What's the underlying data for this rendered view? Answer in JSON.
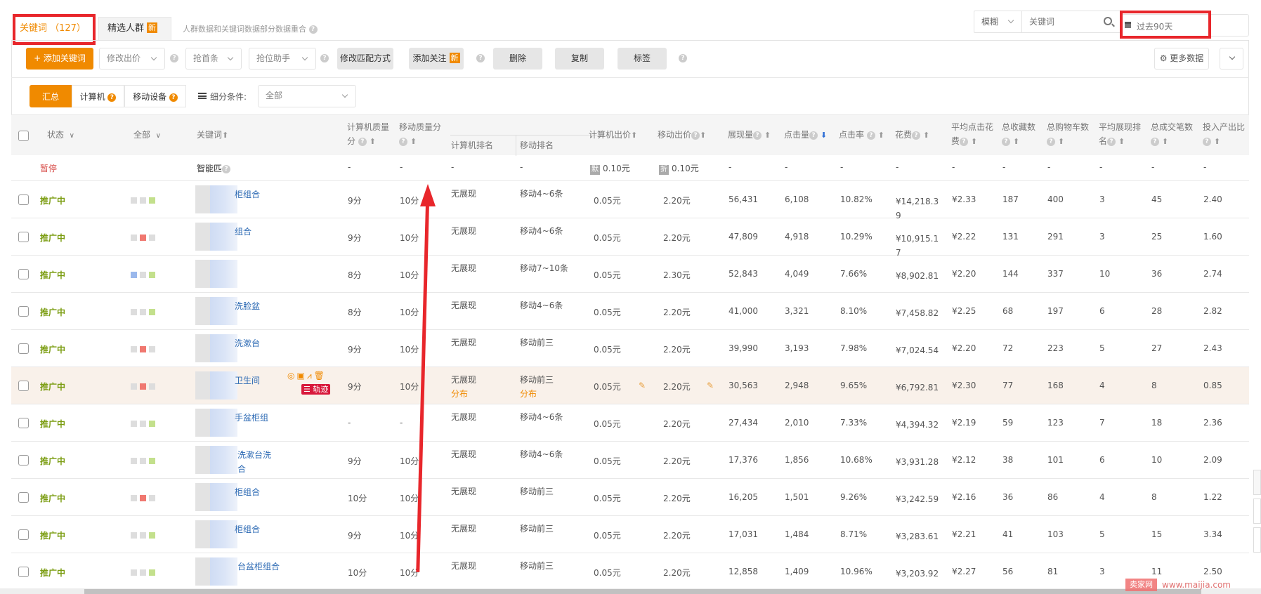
{
  "tabs": {
    "keywords": "关键词 （127）",
    "crowd": "精选人群",
    "crowd_badge": "新",
    "note": "人群数据和关键词数据部分数据重合"
  },
  "search": {
    "mode": "模糊",
    "placeholder": "关键词",
    "icon": "search-icon"
  },
  "date_range": "过去90天",
  "toolbar": {
    "add_keyword": "+ 添加关键词",
    "modify_bid": "修改出价",
    "grab_first": "抢首条",
    "rank_helper": "抢位助手",
    "modify_match": "修改匹配方式",
    "add_follow": "添加关注",
    "add_follow_badge": "新",
    "delete": "删除",
    "copy": "复制",
    "tag": "标签",
    "more_data": "更多数据"
  },
  "segments": {
    "summary": "汇总",
    "pc": "计算机",
    "mobile": "移动设备",
    "filter_label": "细分条件:",
    "filter_value": "全部"
  },
  "columns": {
    "status": "状态",
    "all": "全部",
    "keyword": "关键词",
    "pc_quality_1": "计算机质量",
    "pc_quality_2": "分",
    "mobile_quality_1": "移动质量分",
    "pc_rank": "计算机排名",
    "mobile_rank": "移动排名",
    "pc_bid": "计算机出价",
    "mobile_bid": "移动出价",
    "impressions": "展现量",
    "clicks": "点击量",
    "ctr": "点击率",
    "cost": "花费",
    "avg_cpc_1": "平均点击花",
    "avg_cpc_2": "费",
    "favorites": "总收藏数",
    "carts": "总购物车数",
    "avg_rank_1": "平均展现排",
    "avg_rank_2": "名",
    "orders": "总成交笔数",
    "roi": "投入产出比"
  },
  "smart_row": {
    "status": "暂停",
    "keyword": "智能匹",
    "pc_q": "-",
    "m_q": "-",
    "pc_rank": "-",
    "m_rank": "-",
    "pc_bid_tag": "默",
    "pc_bid": "0.10元",
    "m_bid_tag": "折",
    "m_bid": "0.10元",
    "impressions": "-",
    "clicks": "-",
    "ctr": "-",
    "cost": "-",
    "cpc": "-",
    "fav": "-",
    "cart": "-",
    "rank": "-",
    "orders": "-",
    "roi": "-"
  },
  "rows": [
    {
      "status": "推广中",
      "squares": [
        "n",
        "n",
        "g"
      ],
      "keyword": "柜组合",
      "pc_q": "9分",
      "m_q": "10分",
      "pc_rank": "无展现",
      "m_rank": "移动4~6条",
      "pc_bid": "0.05元",
      "m_bid": "2.20元",
      "impressions": "56,431",
      "clicks": "6,108",
      "ctr": "10.82%",
      "cost": "¥14,218.39",
      "cpc": "¥2.33",
      "fav": "187",
      "cart": "400",
      "rank": "3",
      "orders": "45",
      "roi": "2.40"
    },
    {
      "status": "推广中",
      "squares": [
        "n",
        "r",
        "n"
      ],
      "keyword": "组合",
      "pc_q": "9分",
      "m_q": "10分",
      "pc_rank": "无展现",
      "m_rank": "移动4~6条",
      "pc_bid": "0.05元",
      "m_bid": "2.20元",
      "impressions": "47,809",
      "clicks": "4,918",
      "ctr": "10.29%",
      "cost": "¥10,915.17",
      "cpc": "¥2.22",
      "fav": "131",
      "cart": "291",
      "rank": "3",
      "orders": "25",
      "roi": "1.60"
    },
    {
      "status": "推广中",
      "squares": [
        "b",
        "n",
        "g"
      ],
      "keyword": "",
      "pc_q": "8分",
      "m_q": "10分",
      "pc_rank": "无展现",
      "m_rank": "移动7~10条",
      "pc_bid": "0.05元",
      "m_bid": "2.30元",
      "impressions": "52,843",
      "clicks": "4,049",
      "ctr": "7.66%",
      "cost": "¥8,902.81",
      "cpc": "¥2.20",
      "fav": "144",
      "cart": "337",
      "rank": "10",
      "orders": "36",
      "roi": "2.74"
    },
    {
      "status": "推广中",
      "squares": [
        "n",
        "n",
        "g"
      ],
      "keyword": "洗脸盆",
      "pc_q": "8分",
      "m_q": "10分",
      "pc_rank": "无展现",
      "m_rank": "移动4~6条",
      "pc_bid": "0.05元",
      "m_bid": "2.20元",
      "impressions": "41,000",
      "clicks": "3,321",
      "ctr": "8.10%",
      "cost": "¥7,458.82",
      "cpc": "¥2.25",
      "fav": "68",
      "cart": "197",
      "rank": "6",
      "orders": "28",
      "roi": "2.82"
    },
    {
      "status": "推广中",
      "squares": [
        "n",
        "r",
        "n"
      ],
      "keyword": "洗漱台",
      "pc_q": "9分",
      "m_q": "10分",
      "pc_rank": "无展现",
      "m_rank": "移动前三",
      "pc_bid": "0.05元",
      "m_bid": "2.20元",
      "impressions": "39,990",
      "clicks": "3,193",
      "ctr": "7.98%",
      "cost": "¥7,024.54",
      "cpc": "¥2.20",
      "fav": "72",
      "cart": "223",
      "rank": "5",
      "orders": "27",
      "roi": "2.43"
    },
    {
      "status": "推广中",
      "squares": [
        "n",
        "r",
        "n"
      ],
      "keyword": "卫生间",
      "pc_q": "9分",
      "m_q": "10分",
      "pc_rank": "无展现",
      "m_rank": "移动前三",
      "pc_rank_sub": "分布",
      "m_rank_sub": "分布",
      "pc_bid": "0.05元",
      "m_bid": "2.20元",
      "impressions": "30,563",
      "clicks": "2,948",
      "ctr": "9.65%",
      "cost": "¥6,792.81",
      "cpc": "¥2.30",
      "fav": "77",
      "cart": "168",
      "rank": "4",
      "orders": "8",
      "roi": "0.85",
      "track": "轨迹",
      "highlight": true
    },
    {
      "status": "推广中",
      "squares": [
        "n",
        "n",
        "g"
      ],
      "keyword": "手盆柜组",
      "pc_q": "-",
      "m_q": "-",
      "pc_rank": "无展现",
      "m_rank": "移动4~6条",
      "pc_bid": "0.05元",
      "m_bid": "2.20元",
      "impressions": "27,434",
      "clicks": "2,010",
      "ctr": "7.33%",
      "cost": "¥4,394.32",
      "cpc": "¥2.19",
      "fav": "59",
      "cart": "123",
      "rank": "7",
      "orders": "18",
      "roi": "2.36"
    },
    {
      "status": "推广中",
      "squares": [
        "n",
        "n",
        "g"
      ],
      "keyword": "洗漱台洗 合",
      "pc_q": "9分",
      "m_q": "10分",
      "pc_rank": "无展现",
      "m_rank": "移动4~6条",
      "pc_bid": "0.05元",
      "m_bid": "2.20元",
      "impressions": "17,376",
      "clicks": "1,856",
      "ctr": "10.68%",
      "cost": "¥3,931.28",
      "cpc": "¥2.12",
      "fav": "38",
      "cart": "101",
      "rank": "6",
      "orders": "10",
      "roi": "2.09"
    },
    {
      "status": "推广中",
      "squares": [
        "n",
        "r",
        "n"
      ],
      "keyword": "柜组合",
      "pc_q": "10分",
      "m_q": "10分",
      "pc_rank": "无展现",
      "m_rank": "移动前三",
      "pc_bid": "0.05元",
      "m_bid": "2.20元",
      "impressions": "16,205",
      "clicks": "1,501",
      "ctr": "9.26%",
      "cost": "¥3,242.59",
      "cpc": "¥2.16",
      "fav": "36",
      "cart": "86",
      "rank": "4",
      "orders": "8",
      "roi": "1.22"
    },
    {
      "status": "推广中",
      "squares": [
        "n",
        "n",
        "g"
      ],
      "keyword": "柜组合",
      "pc_q": "9分",
      "m_q": "10分",
      "pc_rank": "无展现",
      "m_rank": "移动前三",
      "pc_bid": "0.05元",
      "m_bid": "2.20元",
      "impressions": "17,031",
      "clicks": "1,484",
      "ctr": "8.71%",
      "cost": "¥3,283.61",
      "cpc": "¥2.21",
      "fav": "41",
      "cart": "103",
      "rank": "5",
      "orders": "15",
      "roi": "3.34"
    },
    {
      "status": "推广中",
      "squares": [
        "n",
        "n",
        "g"
      ],
      "keyword": "台盆柜组合",
      "pc_q": "10分",
      "m_q": "10分",
      "pc_rank": "无展现",
      "m_rank": "移动前三",
      "pc_bid": "0.05元",
      "m_bid": "2.20元",
      "impressions": "12,858",
      "clicks": "1,409",
      "ctr": "10.96%",
      "cost": "¥3,203.92",
      "cpc": "¥2.27",
      "fav": "56",
      "cart": "81",
      "rank": "3",
      "orders": "11",
      "roi": "2.50"
    }
  ],
  "watermark": {
    "brand": "卖家网",
    "url": "www.maijia.com"
  }
}
